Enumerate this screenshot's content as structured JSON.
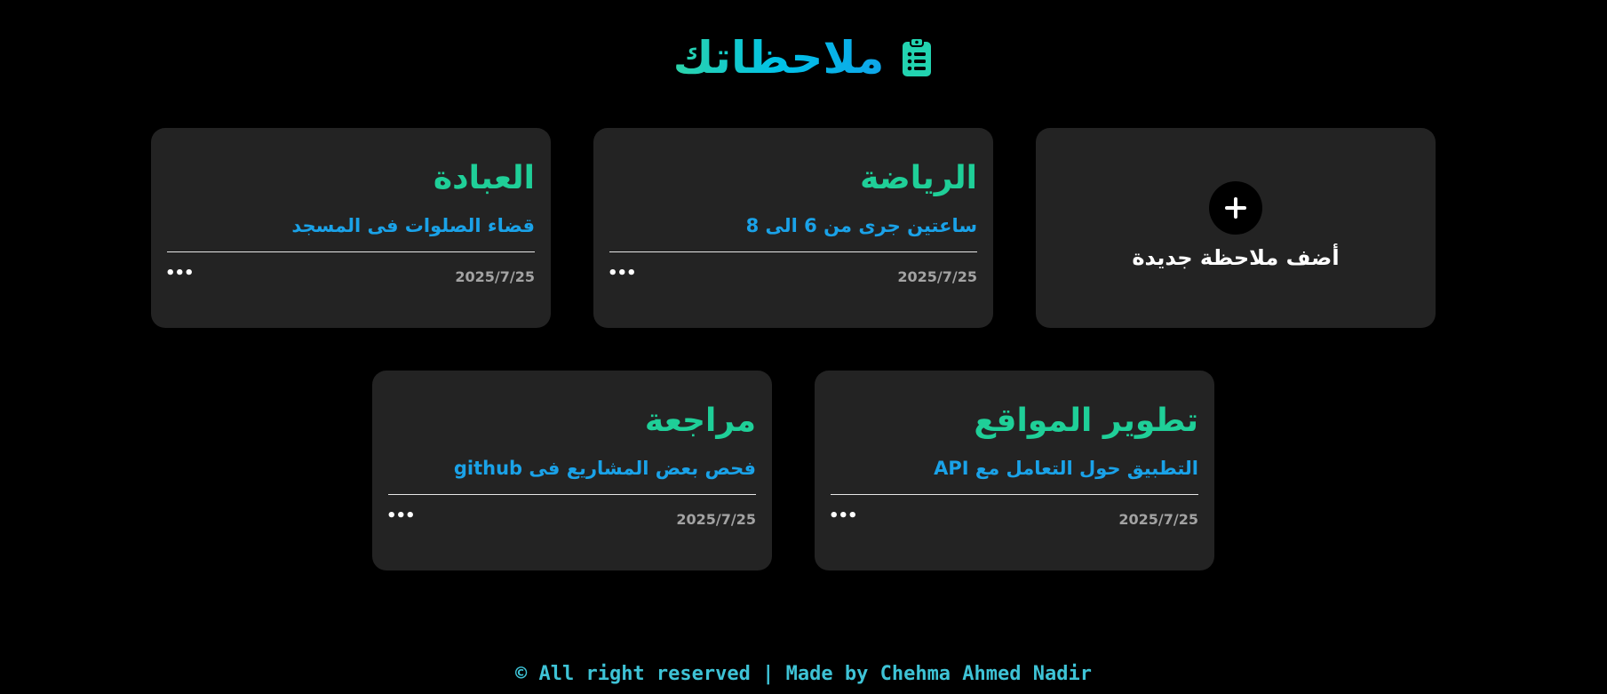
{
  "header": {
    "title": "ملاحظاتك",
    "icon": "clipboard-list-icon"
  },
  "add_card": {
    "label": "أضف ملاحظة جديدة",
    "icon": "plus-icon"
  },
  "notes": [
    {
      "title": "الرياضة",
      "description": "ساعتين جرى من 6 الى 8",
      "date": "2025/7/25",
      "menu": "•••"
    },
    {
      "title": "العبادة",
      "description": "قضاء الصلوات فى المسجد",
      "date": "2025/7/25",
      "menu": "•••"
    },
    {
      "title": "تطوير المواقع",
      "description": "التطبيق حول التعامل مع API",
      "date": "2025/7/25",
      "menu": "•••"
    },
    {
      "title": "مراجعة",
      "description": "فحص بعض المشاريع فى github",
      "date": "2025/7/25",
      "menu": "•••"
    }
  ],
  "footer": {
    "text": "© All right reserved | Made by Chehma Ahmed Nadir"
  },
  "colors": {
    "background": "#000000",
    "card": "#232323",
    "note_title": "#1fcf98",
    "note_description": "#1aa2e8",
    "date": "#a3a3a3",
    "footer": "#3ec3d6",
    "title_gradient_start": "#2dd4a8",
    "title_gradient_end": "#0ea5e9"
  }
}
